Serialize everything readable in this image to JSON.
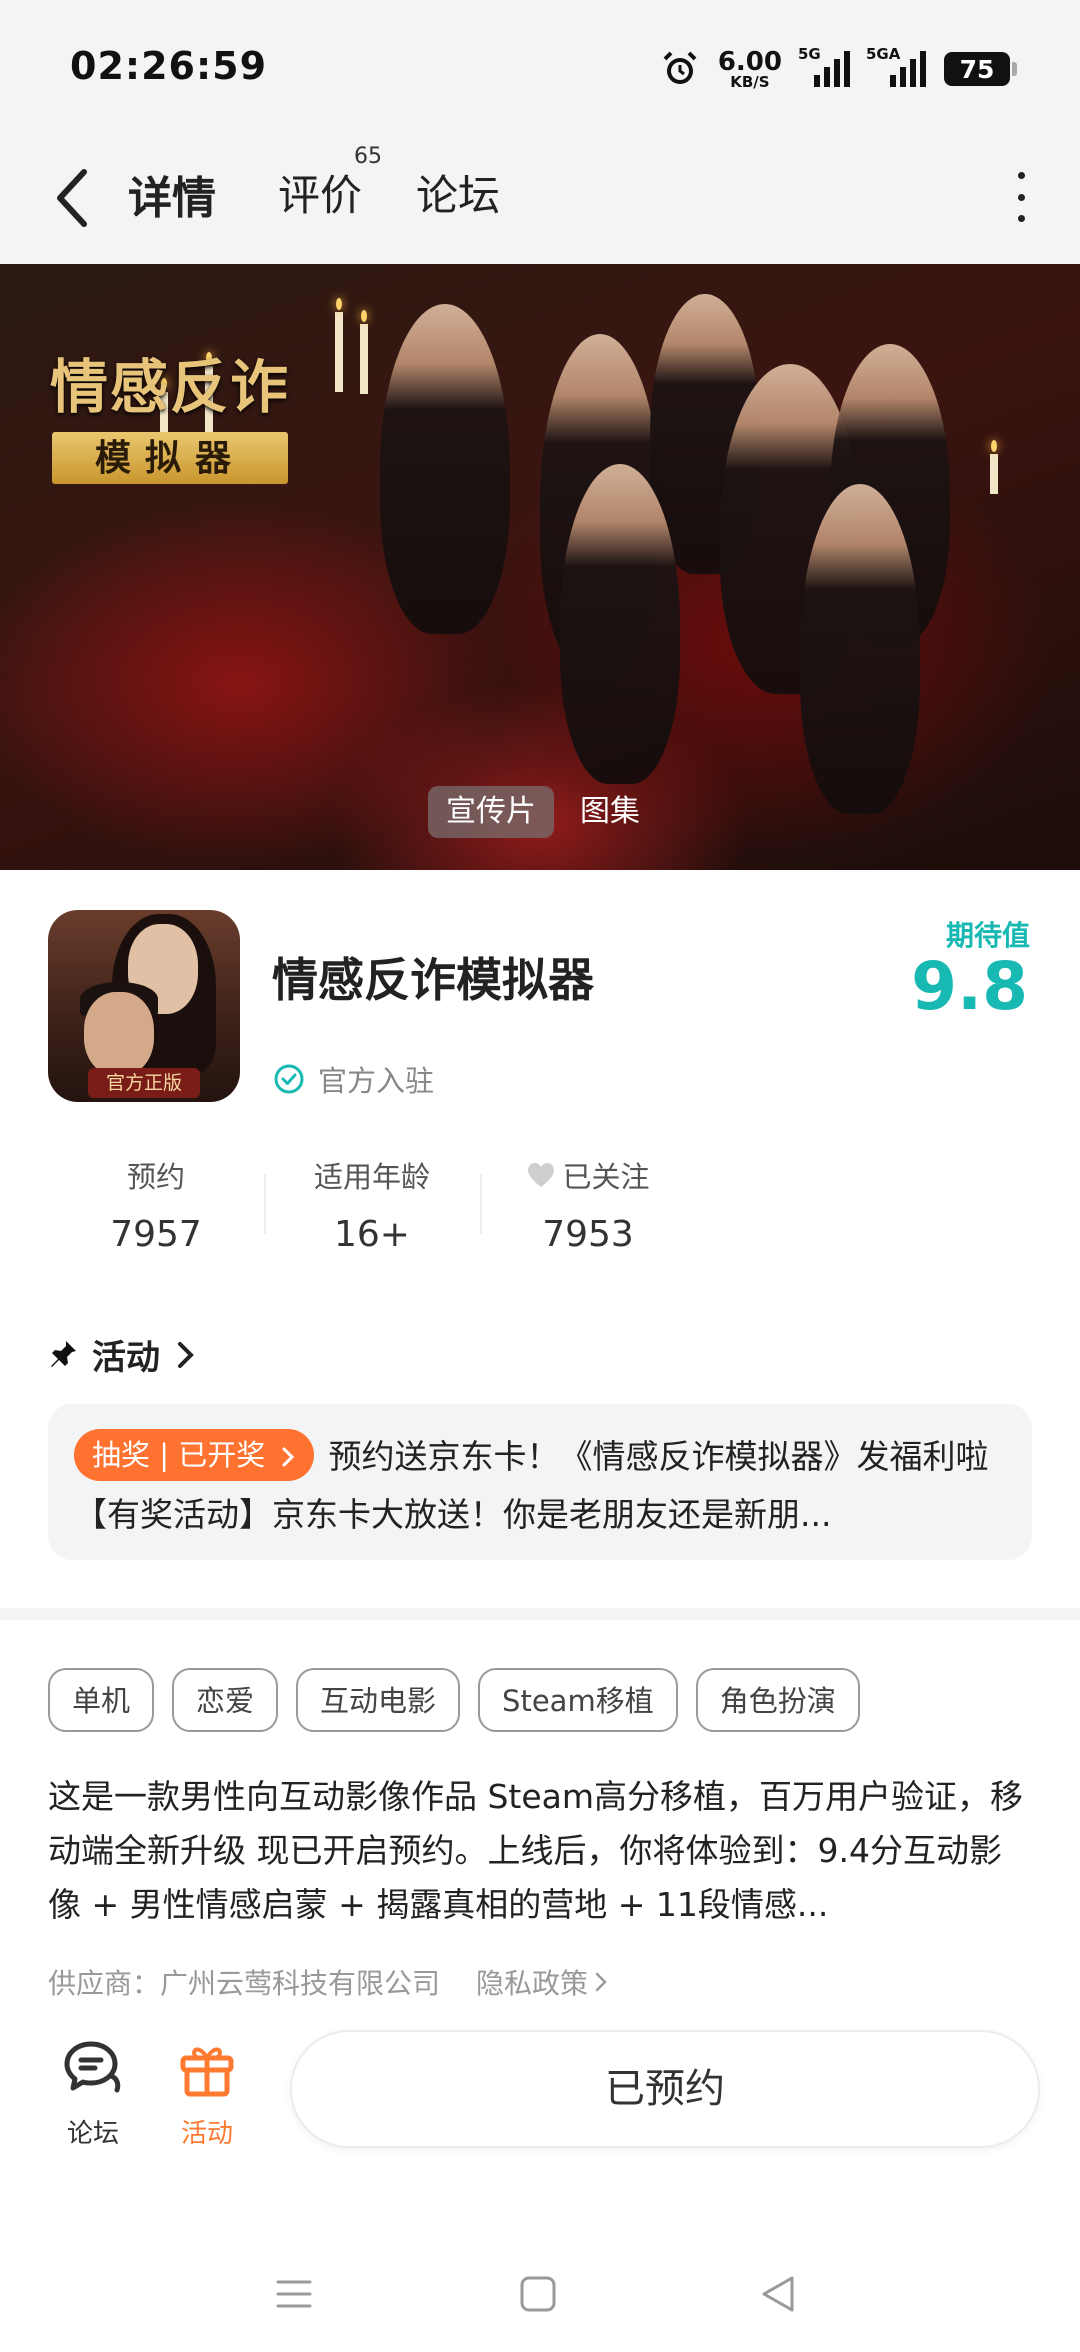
{
  "status_bar": {
    "time": "02:26:59",
    "net_speed": "6.00",
    "net_unit": "KB/S",
    "signal1_label": "5G",
    "signal2_label": "5GA",
    "battery": "75"
  },
  "header": {
    "tabs": [
      {
        "label": "详情",
        "active": true
      },
      {
        "label": "评价",
        "count": "65"
      },
      {
        "label": "论坛"
      }
    ]
  },
  "banner": {
    "title_line1": "情感反诈",
    "title_line2": "模拟器",
    "media_tabs": [
      {
        "label": "宣传片",
        "active": true
      },
      {
        "label": "图集"
      }
    ]
  },
  "app": {
    "icon_badge": "官方正版",
    "name": "情感反诈模拟器",
    "official_label": "官方入驻",
    "score_label": "期待值",
    "score_value": "9.8",
    "stats": [
      {
        "label": "预约",
        "value": "7957"
      },
      {
        "label": "适用年龄",
        "value": "16+"
      },
      {
        "label": "已关注",
        "value": "7953"
      }
    ]
  },
  "activity": {
    "heading": "活动",
    "badge": "抽奖 | 已开奖",
    "text": "预约送京东卡！《情感反诈模拟器》发福利啦 【有奖活动】京东卡大放送！你是老朋友还是新朋..."
  },
  "tags": [
    "单机",
    "恋爱",
    "互动电影",
    "Steam移植",
    "角色扮演"
  ],
  "description": "这是一款男性向互动影像作品 Steam高分移植，百万用户验证，移动端全新升级 现已开启预约。上线后，你将体验到：9.4分互动影像 + 男性情感启蒙 + 揭露真相的营地 + 11段情感...",
  "supplier": {
    "label": "供应商：广州云莺科技有限公司",
    "privacy": "隐私政策"
  },
  "bottom_bar": {
    "forum_label": "论坛",
    "activity_label": "活动",
    "reserve_label": "已预约"
  },
  "colors": {
    "accent_teal": "#18b9b2",
    "accent_orange": "#ff7230"
  }
}
